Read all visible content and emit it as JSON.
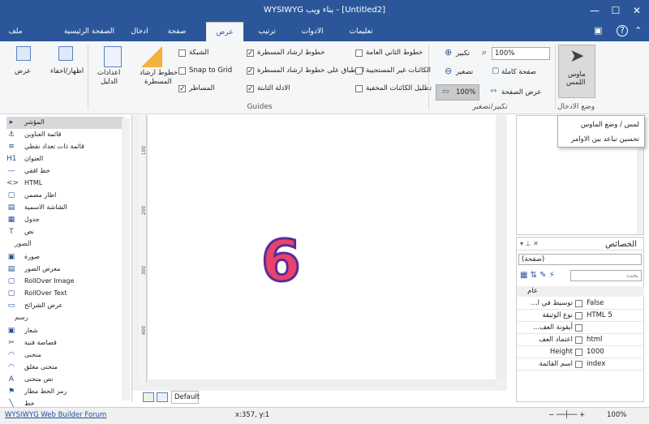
{
  "window": {
    "title": "WYSIWYG بناء ويب - [Untitled2]",
    "minimize": "—",
    "maximize": "☐",
    "close": "✕"
  },
  "menu": {
    "icons_left": [
      "▣",
      "?",
      "⌃"
    ]
  },
  "tabs": [
    "ملف",
    "الصفحة الرئيسية",
    "ادخال",
    "صفحة",
    "عرض",
    "ترتيب",
    "الادوات",
    "تعليمات"
  ],
  "ribbon": {
    "zoom": {
      "zoom_in": "تكبير",
      "zoom_out": "تصغير",
      "zoom_value": "100%",
      "full_page": "صفحة كاملة",
      "page_width": "عرض الصفحة",
      "hundred": "100%",
      "group": "تكبير/تصغير"
    },
    "guides": {
      "grid": "الشبكة",
      "snap": "Snap to Grid",
      "rulers": "المساطر",
      "ruler_guides": "خطوط ارشاد المسطرة",
      "snap_ruler_guides": "الانطباق على خطوط ارشاد المسطرة",
      "page_guide": "الادلة الثابتة",
      "line_guides": "خطوط الثاني العامة",
      "unsized_objects": "الكائنات غير المستجيبة",
      "hidden_objects": "تظليل الكائنات المخفية",
      "ruler_btn_l1": "خطوط ارشاد",
      "ruler_btn_l2": "المسطرة",
      "guide_settings_l1": "اعدادات",
      "guide_settings_l2": "الدليل",
      "group": "Guides"
    },
    "view": {
      "show_hide": "اظهار/اخفاء",
      "view": "عرض"
    },
    "input_mode": {
      "mouse_l1": "ماوس",
      "mouse_l2": "اللمس",
      "group": "وضع الادخال"
    }
  },
  "toolbox": {
    "items": [
      {
        "icon": "▸",
        "label": "المؤشر"
      },
      {
        "icon": "⚓",
        "label": "قائمة العناوين"
      },
      {
        "icon": "≡",
        "label": "قائمة ذات تعداد نقطي"
      },
      {
        "icon": "H1",
        "label": "العنوان"
      },
      {
        "icon": "—",
        "label": "خط افقي"
      },
      {
        "icon": "<>",
        "label": "HTML"
      },
      {
        "icon": "▢",
        "label": "اطار مضمن"
      },
      {
        "icon": "▤",
        "label": "الشاشة الاسمية"
      },
      {
        "icon": "▦",
        "label": "جدول"
      },
      {
        "icon": "T",
        "label": "نص"
      }
    ],
    "images_section": "الصور",
    "images": [
      {
        "icon": "▣",
        "label": "صورة"
      },
      {
        "icon": "▤",
        "label": "معرض الصور"
      },
      {
        "icon": "▢",
        "label": "RollOver Image"
      },
      {
        "icon": "▢",
        "label": "RollOver Text"
      },
      {
        "icon": "▭",
        "label": "عرض الشرائح"
      }
    ],
    "draw_section": "رسم",
    "draw": [
      {
        "icon": "▣",
        "label": "شعار"
      },
      {
        "icon": "✂",
        "label": "قصاصة فنية"
      },
      {
        "icon": "◠",
        "label": "منحنى"
      },
      {
        "icon": "◠",
        "label": "منحنى مغلق"
      },
      {
        "icon": "A",
        "label": "نص منحنى"
      },
      {
        "icon": "⚑",
        "label": "رمز الخط مطار"
      },
      {
        "icon": "╲",
        "label": "خط"
      }
    ]
  },
  "canvas": {
    "number": "6",
    "ruler_marks": [
      "100",
      "200",
      "300",
      "400"
    ],
    "page_tab": "Default"
  },
  "popup": {
    "items": [
      "لمس / وضع الماوس",
      "تحسين تباعد بين الاوامر"
    ]
  },
  "properties": {
    "title": "الخصائص",
    "selector": "(صفحة)",
    "search_placeholder": "بحث",
    "category": "عام",
    "rows": [
      {
        "name": "...توسيط في ا",
        "value": "False"
      },
      {
        "name": "نوع الوثيقة",
        "value": "HTML 5"
      },
      {
        "name": "...أيقونة العف",
        "value": ""
      },
      {
        "name": "اعتماد العف",
        "value": "html"
      },
      {
        "name": "Height",
        "value": "1000"
      },
      {
        "name": "اسم القائمة",
        "value": "index"
      }
    ]
  },
  "status": {
    "left": "WYSIWYG Web Builder Forum",
    "coords": "x:357, y:1",
    "zoom": "100%"
  }
}
